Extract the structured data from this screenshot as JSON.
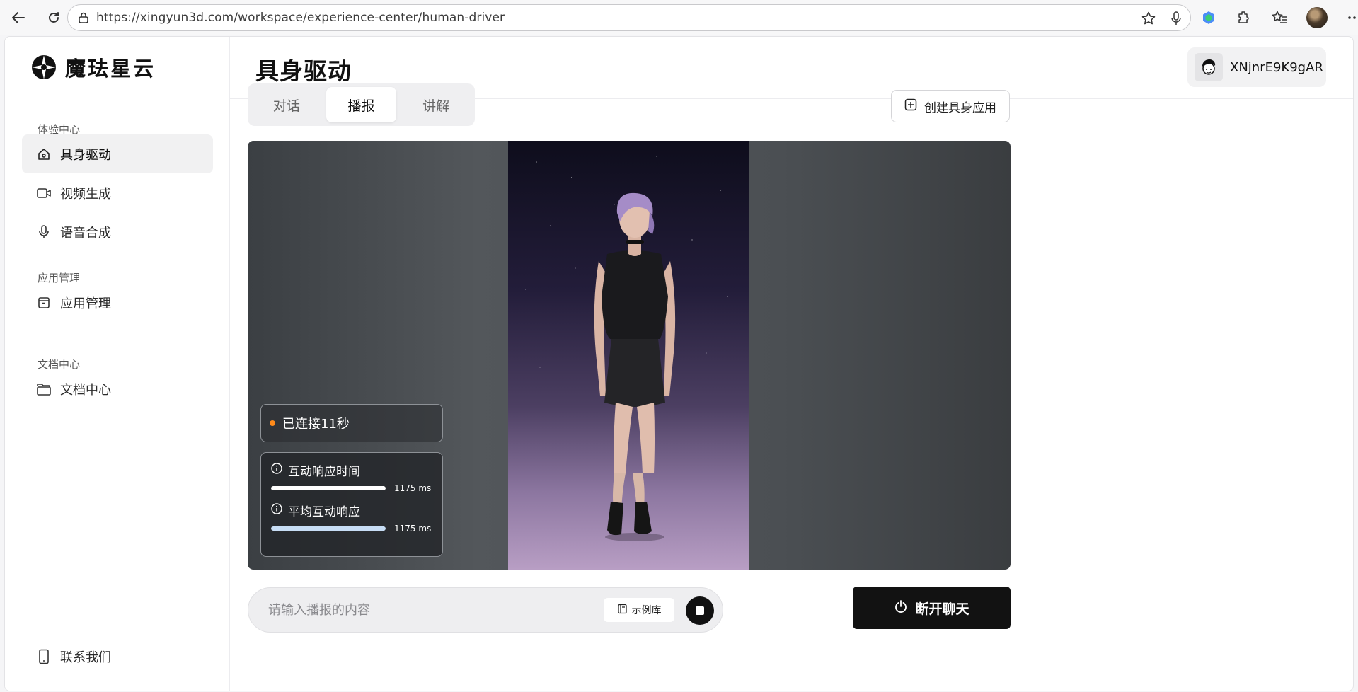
{
  "browser": {
    "url": "https://xingyun3d.com/workspace/experience-center/human-driver"
  },
  "sidebar": {
    "brand": "魔珐星云",
    "sections": [
      {
        "title": "体验中心"
      },
      {
        "title": "应用管理"
      },
      {
        "title": "文档中心"
      }
    ],
    "items": [
      {
        "label": "具身驱动",
        "icon": "home-icon",
        "active": true
      },
      {
        "label": "视频生成",
        "icon": "video-camera-icon"
      },
      {
        "label": "语音合成",
        "icon": "microphone-icon"
      },
      {
        "label": "应用管理",
        "icon": "archive-box-icon"
      },
      {
        "label": "文档中心",
        "icon": "folder-icon"
      }
    ],
    "footer": {
      "label": "联系我们",
      "icon": "phone-icon"
    }
  },
  "header": {
    "title": "具身驱动",
    "username": "XNjnrE9K9gAR"
  },
  "tabs": [
    {
      "label": "对话"
    },
    {
      "label": "播报",
      "active": true
    },
    {
      "label": "讲解"
    }
  ],
  "create_button": {
    "label": "创建具身应用"
  },
  "stage": {
    "status": "已连接11秒",
    "status_color": "#ff8a1a",
    "metrics": [
      {
        "label": "互动响应时间",
        "value": "1175 ms",
        "level": 1.0,
        "color": "#ffffff"
      },
      {
        "label": "平均互动响应",
        "value": "1175 ms",
        "level": 1.0,
        "color": "#c7ddf5"
      }
    ]
  },
  "composer": {
    "placeholder": "请输入播报的内容",
    "examples_label": "示例库"
  },
  "disconnect": {
    "label": "断开聊天"
  }
}
